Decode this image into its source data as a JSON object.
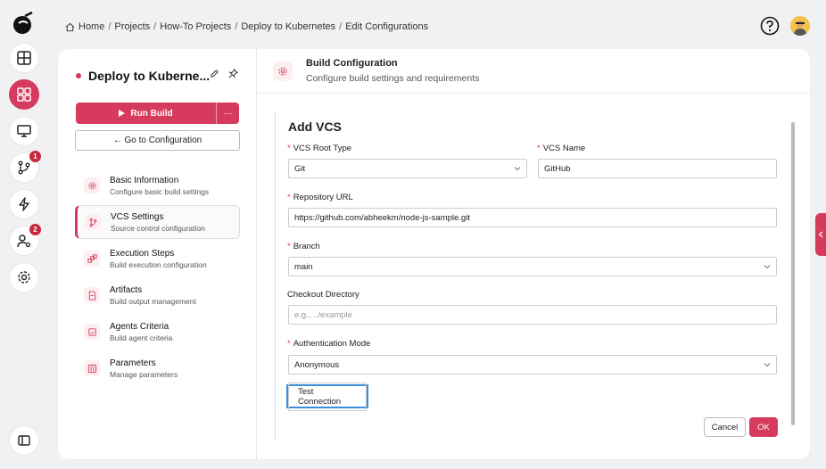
{
  "breadcrumb": {
    "items": [
      "Home",
      "Projects",
      "How-To Projects",
      "Deploy to Kubernetes",
      "Edit Configurations"
    ],
    "separator": "/"
  },
  "rail": {
    "badges": {
      "git": "1",
      "agents": "2"
    }
  },
  "project": {
    "title": "Deploy to Kuberne...",
    "run_label": "Run Build",
    "more_label": "···",
    "goto_label": "← Go to Configuration"
  },
  "nav": {
    "items": [
      {
        "title": "Basic Information",
        "sub": "Configure basic build settings"
      },
      {
        "title": "VCS Settings",
        "sub": "Source control configuration"
      },
      {
        "title": "Execution Steps",
        "sub": "Build execution configuration"
      },
      {
        "title": "Artifacts",
        "sub": "Build output management"
      },
      {
        "title": "Agents Criteria",
        "sub": "Build agent criteria"
      },
      {
        "title": "Parameters",
        "sub": "Manage parameters"
      }
    ]
  },
  "header": {
    "title": "Build Configuration",
    "subtitle": "Configure build settings and requirements"
  },
  "form": {
    "title": "Add VCS",
    "vcs_root_type_label": "VCS Root Type",
    "vcs_root_type_value": "Git",
    "vcs_name_label": "VCS Name",
    "vcs_name_value": "GitHub",
    "repo_url_label": "Repository URL",
    "repo_url_value": "https://github.com/abheekm/node-js-sample.git",
    "branch_label": "Branch",
    "branch_value": "main",
    "checkout_label": "Checkout Directory",
    "checkout_placeholder": "e.g., ../example",
    "auth_label": "Authentication Mode",
    "auth_value": "Anonymous",
    "required_mark": "*",
    "test_label": "Test Connection",
    "cancel_label": "Cancel",
    "ok_label": "OK"
  },
  "colors": {
    "accent": "#d63a5c",
    "focus": "#3a8fde"
  }
}
